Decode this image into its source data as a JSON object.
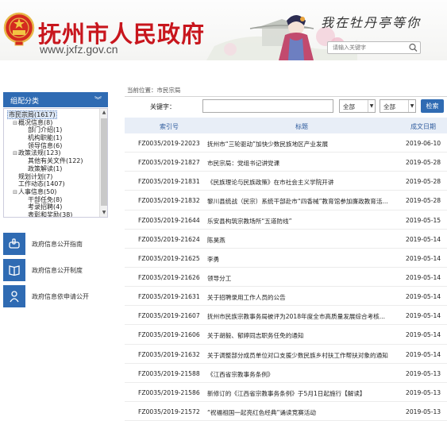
{
  "header": {
    "site_title": "抚州市人民政府",
    "site_url": "www.jxfz.gov.cn",
    "slogan": "我在牡丹亭等你",
    "search_placeholder": "请输入关键字",
    "accent_color": "#c8161d"
  },
  "sidebar": {
    "category_header": "组配分类",
    "tree": [
      {
        "toggle": "",
        "label": "市民宗局(1617)",
        "indent": 0,
        "selected": true
      },
      {
        "toggle": "⊟",
        "label": "概况信息(8)",
        "indent": 1
      },
      {
        "toggle": "",
        "label": "部门介绍(1)",
        "indent": 2
      },
      {
        "toggle": "",
        "label": "机构职能(1)",
        "indent": 2
      },
      {
        "toggle": "",
        "label": "领导信息(6)",
        "indent": 2
      },
      {
        "toggle": "⊟",
        "label": "政策法规(123)",
        "indent": 1
      },
      {
        "toggle": "",
        "label": "其他有关文件(122)",
        "indent": 2
      },
      {
        "toggle": "",
        "label": "政策解读(1)",
        "indent": 2
      },
      {
        "toggle": "",
        "label": "规划计划(7)",
        "indent": 1
      },
      {
        "toggle": "",
        "label": "工作动态(1407)",
        "indent": 1
      },
      {
        "toggle": "⊟",
        "label": "人事信息(50)",
        "indent": 1
      },
      {
        "toggle": "",
        "label": "干部任免(8)",
        "indent": 2
      },
      {
        "toggle": "",
        "label": "考录招聘(4)",
        "indent": 2
      },
      {
        "toggle": "",
        "label": "表彰和奖励(38)",
        "indent": 2
      }
    ],
    "links": [
      {
        "label": "政府信息公开指南",
        "icon": "pointer-hand-icon"
      },
      {
        "label": "政府信息公开制度",
        "icon": "book-icon"
      },
      {
        "label": "政府信息依申请公开",
        "icon": "person-icon"
      }
    ],
    "brand_color": "#2f6bb3"
  },
  "main": {
    "breadcrumb": "当前位置：市民宗局",
    "keyword_label": "关键字：",
    "keyword_value": "",
    "select1": "全部",
    "select2": "全部",
    "search_label": "检索",
    "columns": {
      "index": "索引号",
      "title": "标题",
      "date": "成文日期"
    },
    "rows": [
      {
        "index": "FZ0035/2019-22023",
        "title": "抚州市“三轮驱动”加快少数民族地区产业发展",
        "date": "2019-06-10"
      },
      {
        "index": "FZ0035/2019-21827",
        "title": "市民宗局：党组书记讲党课",
        "date": "2019-05-28"
      },
      {
        "index": "FZ0035/2019-21831",
        "title": "《民族理论与民族政策》在市社会主义学院开讲",
        "date": "2019-05-28"
      },
      {
        "index": "FZ0035/2019-21832",
        "title": "黎川县统战（民宗）系统干部赴市“四香械”教育馆参加廉政教育活...",
        "date": "2019-05-28"
      },
      {
        "index": "FZ0035/2019-21644",
        "title": "乐安县构筑宗教场所“五道防线”",
        "date": "2019-05-15"
      },
      {
        "index": "FZ0035/2019-21624",
        "title": "陈昊燕",
        "date": "2019-05-14"
      },
      {
        "index": "FZ0035/2019-21625",
        "title": "李勇",
        "date": "2019-05-14"
      },
      {
        "index": "FZ0035/2019-21626",
        "title": "领导分工",
        "date": "2019-05-14"
      },
      {
        "index": "FZ0035/2019-21631",
        "title": "关于招聘录用工作人员的公告",
        "date": "2019-05-14"
      },
      {
        "index": "FZ0035/2019-21607",
        "title": "抚州市民族宗教事务局被评为2018年度全市高质量发展综合考核...",
        "date": "2019-05-14"
      },
      {
        "index": "FZ0035/2019-21606",
        "title": "关于胡毅、郁婷同志职务任免的通知",
        "date": "2019-05-14"
      },
      {
        "index": "FZ0035/2019-21632",
        "title": "关于调整部分成员单位对口支援少数民族乡村扶工作帮扶对象的通知",
        "date": "2019-05-14"
      },
      {
        "index": "FZ0035/2019-21588",
        "title": "《江西省宗教事务条例》",
        "date": "2019-05-13"
      },
      {
        "index": "FZ0035/2019-21586",
        "title": "新修订的《江西省宗教事务条例》于5月1日起施行【解读】",
        "date": "2019-05-13"
      },
      {
        "index": "FZ0035/2019-21572",
        "title": "“祝福祖国一起亮红色经典”诵读竞赛活动",
        "date": "2019-05-13"
      }
    ]
  }
}
